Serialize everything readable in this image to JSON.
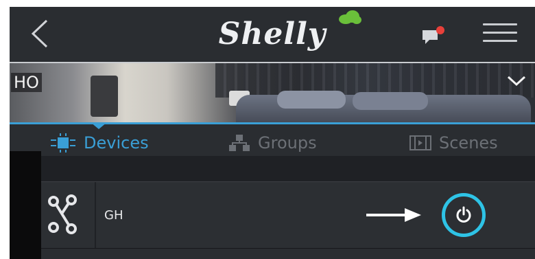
{
  "header": {
    "logo_text": "Shelly",
    "icons": {
      "back": "chevron-left-icon",
      "cloud": "cloud-icon",
      "messages": "chat-notification-icon",
      "menu": "hamburger-menu-icon"
    },
    "colors": {
      "cloud": "#6abf3a",
      "notification_dot": "#e8403a"
    }
  },
  "room": {
    "name": "HO",
    "dropdown_icon": "chevron-down-icon"
  },
  "tabs": [
    {
      "label": "Devices",
      "icon": "chip-icon",
      "active": true
    },
    {
      "label": "Groups",
      "icon": "groups-icon",
      "active": false
    },
    {
      "label": "Scenes",
      "icon": "film-scenes-icon",
      "active": false
    }
  ],
  "device": {
    "name": "GH",
    "icon": "relay-device-icon",
    "power_icon": "power-icon"
  },
  "colors": {
    "accent": "#3a9fd6",
    "power_ring": "#2ec3e6",
    "background": "#1f2125"
  }
}
